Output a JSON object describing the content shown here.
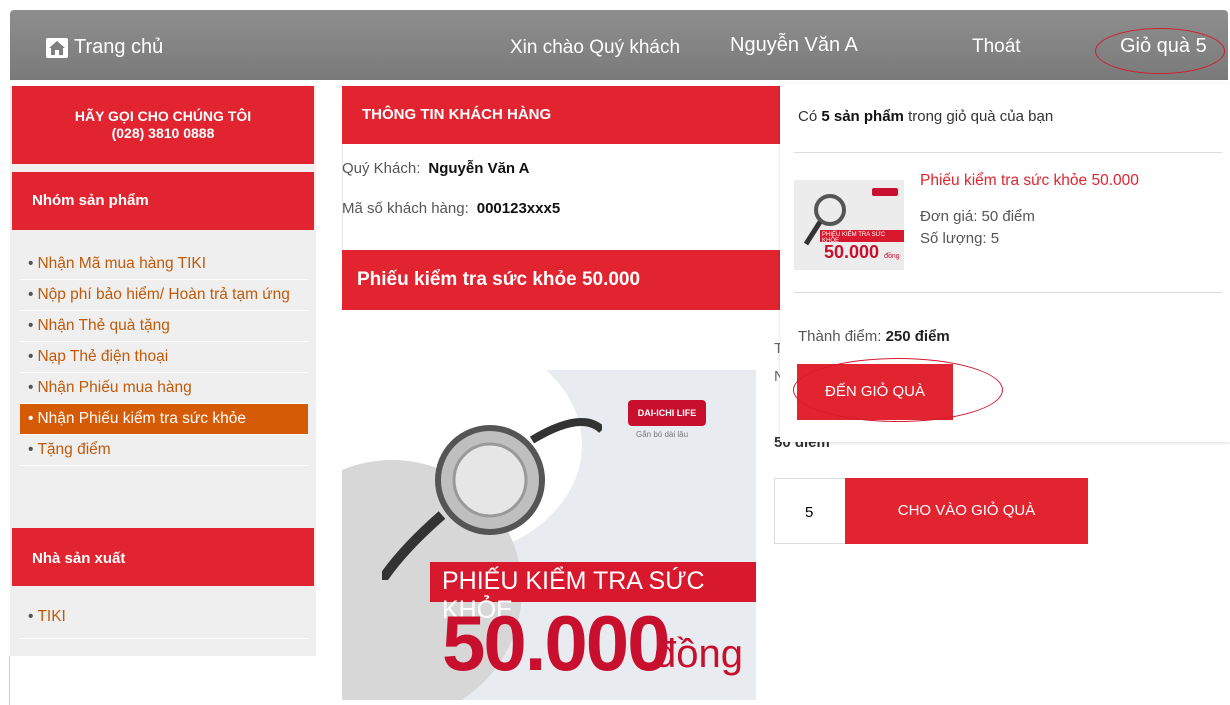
{
  "header": {
    "home_label": "Trang chủ",
    "welcome": "Xin chào Quý khách",
    "username": "Nguyễn Văn A",
    "logout": "Thoát",
    "cart_label": "Giỏ quà 5"
  },
  "sidebar": {
    "call_line1": "HÃY GỌI CHO CHÚNG TÔI",
    "call_line2": "(028) 3810 0888",
    "group_title": "Nhóm sản phẩm",
    "items": [
      {
        "label": "Nhận Mã mua hàng TIKI"
      },
      {
        "label": "Nộp phí bảo hiểm/ Hoàn trả tạm ứng"
      },
      {
        "label": "Nhận Thẻ quà tặng"
      },
      {
        "label": "Nạp Thẻ điện thoại"
      },
      {
        "label": "Nhận Phiếu mua hàng"
      },
      {
        "label": "Nhận Phiếu kiểm tra sức khỏe"
      },
      {
        "label": "Tặng điểm"
      }
    ],
    "maker_title": "Nhà sản xuất",
    "makers": [
      {
        "label": "TIKI"
      }
    ]
  },
  "customer": {
    "title": "THÔNG TIN KHÁCH HÀNG",
    "name_label": "Quý Khách:",
    "name_value": "Nguyễn Văn A",
    "id_label": "Mã số khách hàng:",
    "id_value": "000123xxx5"
  },
  "product": {
    "title": "Phiếu kiểm tra sức khỏe 50.000",
    "voucher_logo": "DAI-ICHI LIFE",
    "voucher_tagline": "Gắn bó dài lâu",
    "voucher_heading": "PHIẾU KIỂM TRA SỨC KHỎE",
    "voucher_amount": "50.000",
    "voucher_currency": "đồng",
    "points": "50 điểm",
    "quantity": "5",
    "add_button": "CHO VÀO GIỎ QUÀ",
    "partial_t": "T",
    "partial_n": "N"
  },
  "cart_dropdown": {
    "summary_prefix": "Có",
    "summary_count": "5 sản phẩm",
    "summary_suffix": "trong giỏ quà của bạn",
    "item_name": "Phiếu kiểm tra sức khỏe 50.000",
    "item_price": "Đơn giá: 50 điểm",
    "item_qty": "Số lượng: 5",
    "thumb_heading": "PHIẾU KIỂM TRA SỨC KHỎE",
    "thumb_amount": "50.000",
    "thumb_currency": "đồng",
    "total_label": "Thành điểm:",
    "total_value": "250 điểm",
    "go_button": "ĐẾN GIỎ QUÀ"
  },
  "colors": {
    "accent_red": "#e1242f",
    "active_orange": "#d55b07",
    "link_orange": "#c05a0a",
    "topbar_gray": "#858585"
  }
}
